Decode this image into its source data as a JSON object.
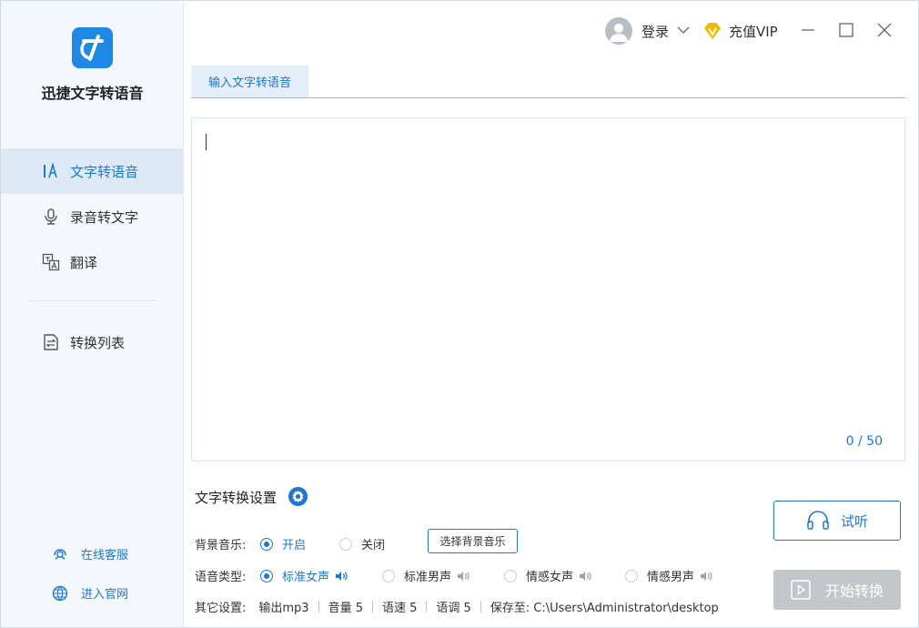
{
  "app": {
    "name": "迅捷文字转语音"
  },
  "colors": {
    "accent": "#1e78d2",
    "sidebar_bg": "#f4f8fc",
    "active_bg": "#dde9f6",
    "vip": "#f5b800",
    "disabled": "#c3c6ca"
  },
  "sidebar": {
    "items": [
      {
        "label": "文字转语音",
        "icon": "text-to-speech-icon",
        "active": true
      },
      {
        "label": "录音转文字",
        "icon": "microphone-icon",
        "active": false
      },
      {
        "label": "翻译",
        "icon": "translate-icon",
        "active": false
      },
      {
        "label": "转换列表",
        "icon": "conversion-list-icon",
        "active": false
      }
    ],
    "links": [
      {
        "label": "在线客服",
        "icon": "customer-service-icon"
      },
      {
        "label": "进入官网",
        "icon": "globe-icon"
      }
    ]
  },
  "titlebar": {
    "login_label": "登录",
    "vip_label": "充值VIP"
  },
  "tab": {
    "label": "输入文字转语音"
  },
  "editor": {
    "value": "",
    "char_count": "0 / 50"
  },
  "settings": {
    "title": "文字转换设置",
    "background_music": {
      "label": "背景音乐:",
      "options": [
        "开启",
        "关闭"
      ],
      "selected": "开启",
      "choose_button": "选择背景音乐"
    },
    "voice_type": {
      "label": "语音类型:",
      "options": [
        "标准女声",
        "标准男声",
        "情感女声",
        "情感男声"
      ],
      "selected": "标准女声"
    },
    "other": {
      "label": "其它设置:",
      "output": "输出mp3",
      "volume": "音量 5",
      "speed": "语速 5",
      "pitch": "语调 5",
      "save_to": "保存至: C:\\Users\\Administrator\\desktop"
    }
  },
  "actions": {
    "listen": "试听",
    "convert": "开始转换"
  }
}
